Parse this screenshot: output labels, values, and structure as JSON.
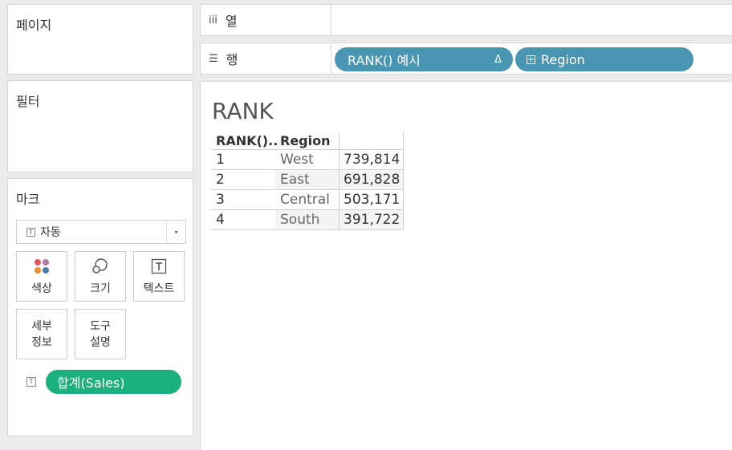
{
  "cards": {
    "pages": "페이지",
    "filters": "필터",
    "marks": "마크"
  },
  "marks": {
    "type_icon": "T",
    "type_label": "자동",
    "dropdown_icon": "▾",
    "buttons": {
      "color": "색상",
      "size": "크기",
      "text": "텍스트",
      "detail": "세부\n정보",
      "tooltip": "도구\n설명"
    },
    "field_icon": "T",
    "field_pill": "합계(Sales)"
  },
  "shelves": {
    "columns_icon": "iii",
    "columns_label": "열",
    "rows_icon": "☰",
    "rows_label": "행",
    "pill_rank": "RANK() 예시",
    "pill_rank_delta": "Δ",
    "pill_region_icon": "+",
    "pill_region": "Region"
  },
  "view": {
    "title": "RANK",
    "headers": {
      "rank": "RANK()..",
      "region": "Region"
    },
    "rows": [
      {
        "rank": "1",
        "region": "West",
        "sales": "739,814"
      },
      {
        "rank": "2",
        "region": "East",
        "sales": "691,828"
      },
      {
        "rank": "3",
        "region": "Central",
        "sales": "503,171"
      },
      {
        "rank": "4",
        "region": "South",
        "sales": "391,722"
      }
    ]
  },
  "colors": {
    "blue_pill": "#4996b2",
    "green_pill": "#1bb17c",
    "color_dots": [
      "#e15759",
      "#b07aa1",
      "#f28e2b",
      "#4e79a7"
    ]
  }
}
